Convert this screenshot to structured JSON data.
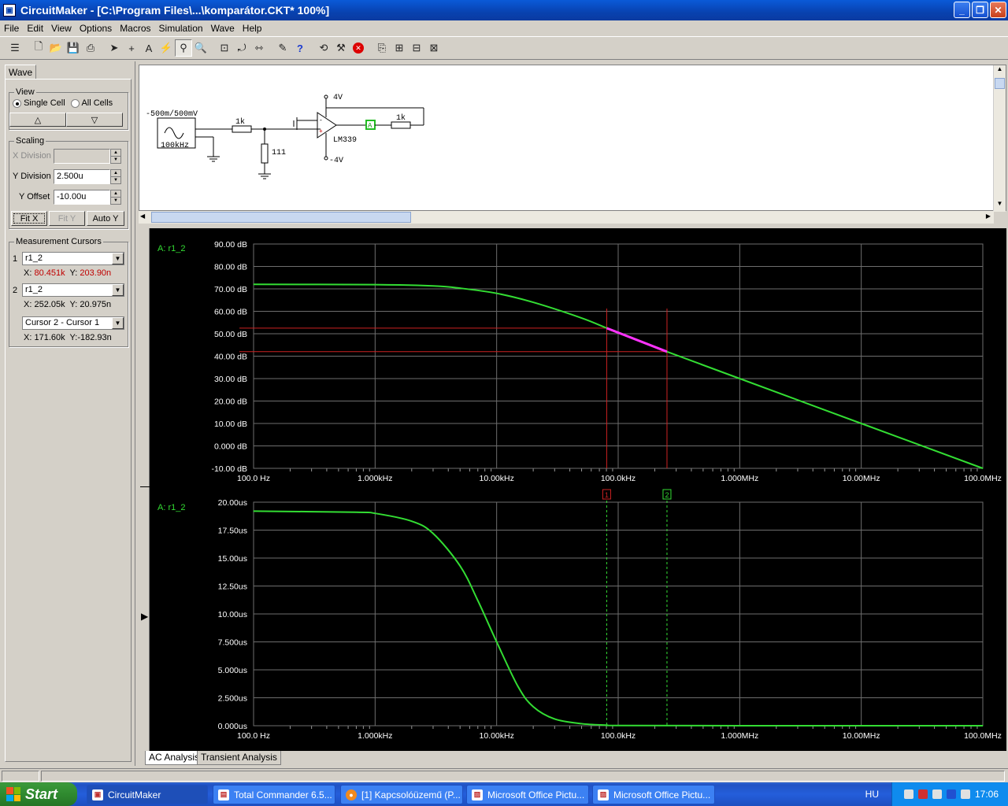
{
  "window": {
    "title": "CircuitMaker - [C:\\Program Files\\...\\komparátor.CKT* 100%]"
  },
  "menu": [
    "File",
    "Edit",
    "View",
    "Options",
    "Macros",
    "Simulation",
    "Wave",
    "Help"
  ],
  "left_panel": {
    "tab": "Wave",
    "view": {
      "label": "View",
      "single_cell": "Single Cell",
      "all_cells": "All Cells",
      "selected": "single_cell"
    },
    "scaling": {
      "label": "Scaling",
      "x_division_label": "X Division",
      "x_division_value": "",
      "y_division_label": "Y Division",
      "y_division_value": "2.500u",
      "y_offset_label": "Y Offset",
      "y_offset_value": "-10.00u",
      "fit_x": "Fit X",
      "fit_y": "Fit Y",
      "auto_y": "Auto Y"
    },
    "cursors": {
      "label": "Measurement Cursors",
      "c1": {
        "num": "1",
        "signal": "r1_2",
        "x_label": "X:",
        "x": "80.451k",
        "y_label": "Y:",
        "y": "203.90n"
      },
      "c2": {
        "num": "2",
        "signal": "r1_2",
        "x_label": "X:",
        "x": "252.05k",
        "y_label": "Y:",
        "y": "20.975n"
      },
      "diff": {
        "mode": "Cursor 2 - Cursor 1",
        "x_label": "X:",
        "x": "171.60k",
        "y_label": "Y:",
        "y": "-182.93n"
      }
    }
  },
  "schematic": {
    "source_label": "-500m/500mV",
    "source_freq": "100kHz",
    "r1": "1k",
    "r2": "111",
    "r3": "1k",
    "vpos": "4V",
    "vneg": "-4V",
    "opamp": "LM339",
    "probe": "A"
  },
  "bottom_tabs": [
    "AC Analysis",
    "Transient Analysis"
  ],
  "taskbar": {
    "start": "Start",
    "tasks": [
      "CircuitMaker",
      "Total Commander 6.5...",
      "[1] Kapcsolóüzemű (P...",
      "Microsoft Office Pictu...",
      "Microsoft Office Pictu..."
    ],
    "lang": "HU",
    "clock": "17:06"
  },
  "colors": {
    "trace": "#33dd33",
    "cursor": "#cc2222",
    "highlight": "#ff33ff",
    "grid": "#6e6e6e"
  },
  "chart_data": [
    {
      "type": "line",
      "title": "A: r1_2",
      "xscale": "log",
      "x_ticks": [
        "100.0 Hz",
        "1.000kHz",
        "10.00kHz",
        "100.0kHz",
        "1.000MHz",
        "10.00MHz",
        "100.0MHz"
      ],
      "y_ticks": [
        "90.00 dB",
        "80.00 dB",
        "70.00 dB",
        "60.00 dB",
        "50.00 dB",
        "40.00 dB",
        "30.00 dB",
        "20.00 dB",
        "10.00 dB",
        "0.000 dB",
        "-10.00 dB"
      ],
      "xlim": [
        100,
        100000000
      ],
      "ylim": [
        -10,
        90
      ],
      "x": [
        100,
        1000,
        3000,
        5000,
        10000,
        20000,
        50000,
        80451,
        100000,
        252050,
        1000000,
        10000000,
        100000000
      ],
      "y": [
        72,
        71.9,
        71.3,
        70.3,
        68,
        64,
        57,
        52.5,
        50.6,
        42,
        30,
        10,
        -10
      ],
      "cursors": {
        "x": [
          80451,
          252050
        ],
        "y": [
          52.5,
          42
        ]
      }
    },
    {
      "type": "line",
      "title": "A: r1_2",
      "xscale": "log",
      "x_ticks": [
        "100.0 Hz",
        "1.000kHz",
        "10.00kHz",
        "100.0kHz",
        "1.000MHz",
        "10.00MHz",
        "100.0MHz"
      ],
      "y_ticks": [
        "20.00us",
        "17.50us",
        "15.00us",
        "12.50us",
        "10.00us",
        "7.500us",
        "5.000us",
        "2.500us",
        "0.000us"
      ],
      "xlim": [
        100,
        100000000
      ],
      "ylim": [
        0,
        20
      ],
      "x": [
        100,
        700,
        1000,
        2000,
        3000,
        5000,
        7000,
        10000,
        15000,
        20000,
        30000,
        50000,
        80000,
        100000,
        1000000,
        100000000
      ],
      "y": [
        19.2,
        19.1,
        19.0,
        18.3,
        17.2,
        14.3,
        11.2,
        7.5,
        3.5,
        1.7,
        0.6,
        0.18,
        0.05,
        0.02,
        0.0,
        0.0
      ],
      "cursor_labels": [
        "1",
        "2"
      ],
      "cursors": {
        "x": [
          80451,
          252050
        ]
      }
    }
  ]
}
